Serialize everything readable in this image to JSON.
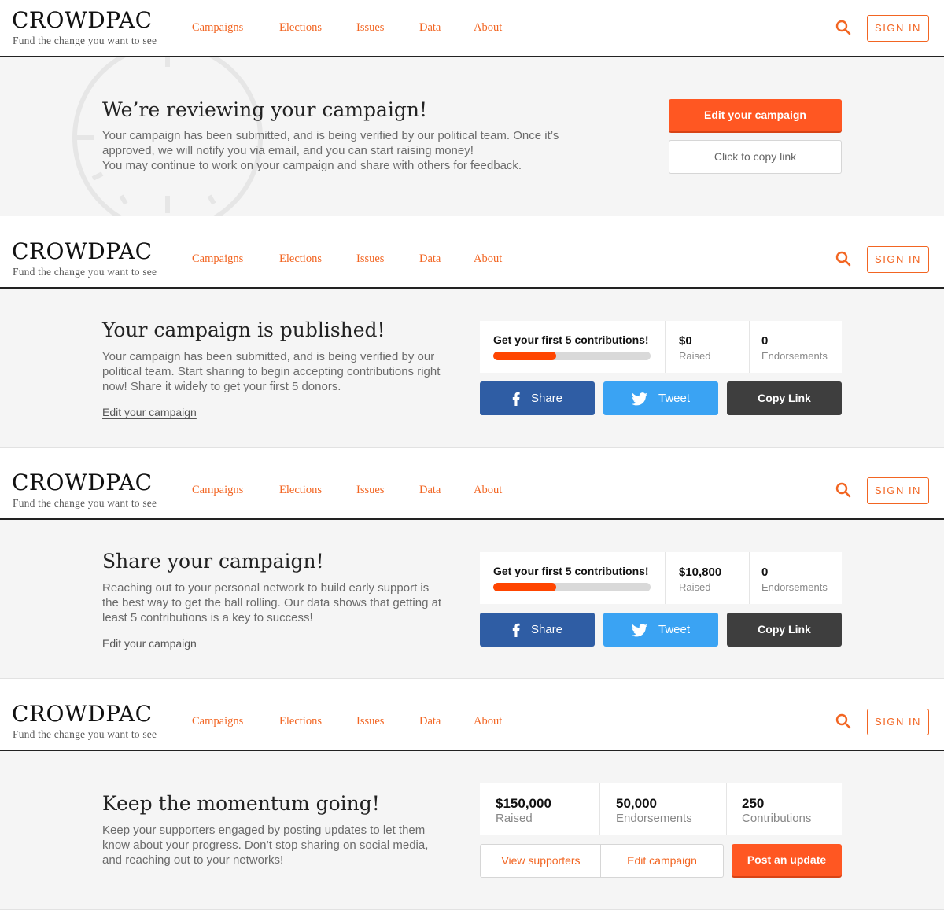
{
  "brand": {
    "logo": "CROWDPAC",
    "tagline": "Fund the change you want to see",
    "accent_color": "#f26522"
  },
  "nav": [
    "Campaigns",
    "Elections",
    "Issues",
    "Data",
    "About"
  ],
  "signin_label": "SIGN IN",
  "search_icon": "search-icon",
  "reviewing": {
    "title": "We’re reviewing your campaign!",
    "lines": [
      "Your campaign has been submitted, and is being verified by our political team. Once it’s",
      "approved, we will notify you via email, and you can start raising money!",
      "You may continue to work on your campaign and share with others for feedback."
    ],
    "primary_button": "Edit your campaign",
    "secondary_button": "Click to copy link"
  },
  "published": {
    "title": "Your campaign is published!",
    "lines": [
      "Your campaign has been submitted, and is being verified by our",
      "political team. Start sharing to begin accepting contributions right",
      "now! Share it widely to get your first 5 donors."
    ],
    "edit_link": "Edit your campaign",
    "goal": "Get your first 5 contributions!",
    "progress_fraction": 0.4,
    "raised_value": "$0",
    "raised_label": "Raised",
    "endorse_value": "0",
    "endorse_label": "Endorsements",
    "share": "Share",
    "tweet": "Tweet",
    "copy": "Copy Link"
  },
  "share_campaign": {
    "title": "Share your campaign!",
    "lines": [
      "Reaching out to your personal network to build early support is",
      "the best way to get the ball rolling. Our data shows that getting at",
      "least 5 contributions is a key to success!"
    ],
    "edit_link": "Edit your campaign",
    "goal": "Get your first 5 contributions!",
    "progress_fraction": 0.4,
    "raised_value": "$10,800",
    "raised_label": "Raised",
    "endorse_value": "0",
    "endorse_label": "Endorsements",
    "share": "Share",
    "tweet": "Tweet",
    "copy": "Copy Link"
  },
  "momentum": {
    "title": "Keep the momentum going!",
    "lines": [
      "Keep your supporters engaged by posting updates to let them",
      "know about your progress. Don’t stop sharing on social media,",
      "and reaching out to your networks!"
    ],
    "raised_value": "$150,000",
    "raised_label": "Raised",
    "endorse_value": "50,000",
    "endorse_label": "Endorsements",
    "contrib_value": "250",
    "contrib_label": "Contributions",
    "view_supporters": "View supporters",
    "edit_campaign": "Edit campaign",
    "post_update": "Post an update"
  }
}
